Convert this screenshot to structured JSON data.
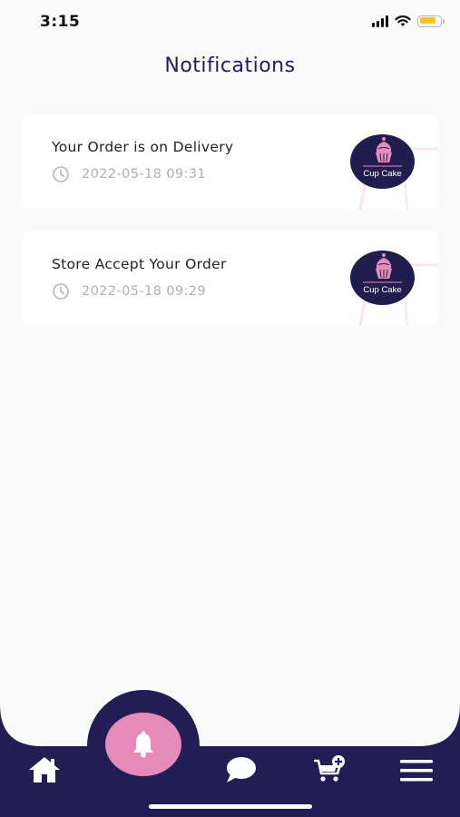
{
  "status_bar": {
    "time": "3:15",
    "battery_level": 0.85
  },
  "page": {
    "title": "Notifications"
  },
  "notifications": [
    {
      "title": "Your Order is on Delivery",
      "timestamp": "2022-05-18 09:31",
      "logo_text": "Cup Cake",
      "time_icon": "clock-icon"
    },
    {
      "title": "Store Accept Your Order",
      "timestamp": "2022-05-18 09:29",
      "logo_text": "Cup Cake",
      "time_icon": "clock-icon"
    }
  ],
  "bottom_nav": {
    "items": [
      "home-icon",
      "bell-icon",
      "chat-icon",
      "cart-add-icon",
      "menu-icon"
    ],
    "active": "bell-icon"
  },
  "colors": {
    "primary_navy": "#221e55",
    "accent_pink": "#e68ab8",
    "title_text": "#1f1c57",
    "muted_text": "#b0b0b0"
  }
}
